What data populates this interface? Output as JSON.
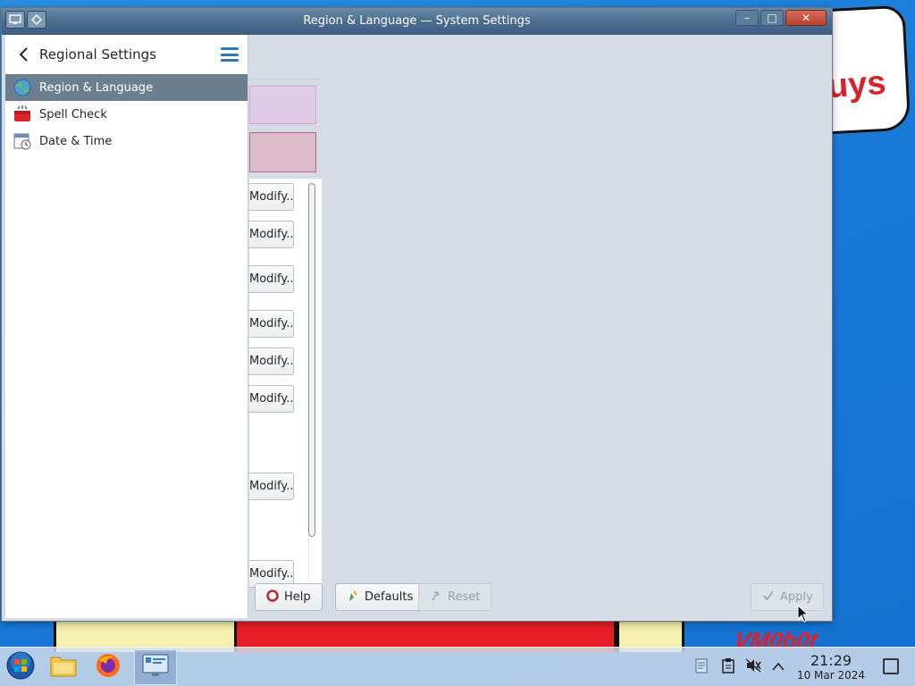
{
  "desktop": {
    "sign_text": "uys",
    "watermark": "VM0b0t"
  },
  "window": {
    "title": "Region & Language — System Settings",
    "controls": {
      "minimize": "–",
      "maximize": "□",
      "close": "✕"
    }
  },
  "sidebar": {
    "title": "Regional Settings",
    "items": [
      {
        "label": "Region & Language",
        "icon": "globe-icon",
        "active": true
      },
      {
        "label": "Spell Check",
        "icon": "spell-check-icon",
        "active": false
      },
      {
        "label": "Date & Time",
        "icon": "calendar-icon",
        "active": false
      }
    ]
  },
  "content": {
    "modify_label": "Modify...",
    "modify_buttons": [
      "Modify...",
      "Modify...",
      "Modify...",
      "Modify...",
      "Modify...",
      "Modify...",
      "Modify...",
      "Modify..."
    ]
  },
  "footer": {
    "help": "Help",
    "defaults": "Defaults",
    "reset": "Reset",
    "apply": "Apply"
  },
  "taskbar": {
    "apps": [
      {
        "name": "start-menu",
        "icon": "windows-orb-icon"
      },
      {
        "name": "file-manager",
        "icon": "folder-icon"
      },
      {
        "name": "firefox",
        "icon": "firefox-icon"
      },
      {
        "name": "system-settings",
        "icon": "system-settings-icon",
        "active": true
      }
    ],
    "clock": {
      "time": "21:29",
      "date": "10 Mar 2024"
    }
  },
  "colors": {
    "accent": "#2d7ab8",
    "selection": "#6b7f8e",
    "titlebar": "#4d6d8e"
  }
}
